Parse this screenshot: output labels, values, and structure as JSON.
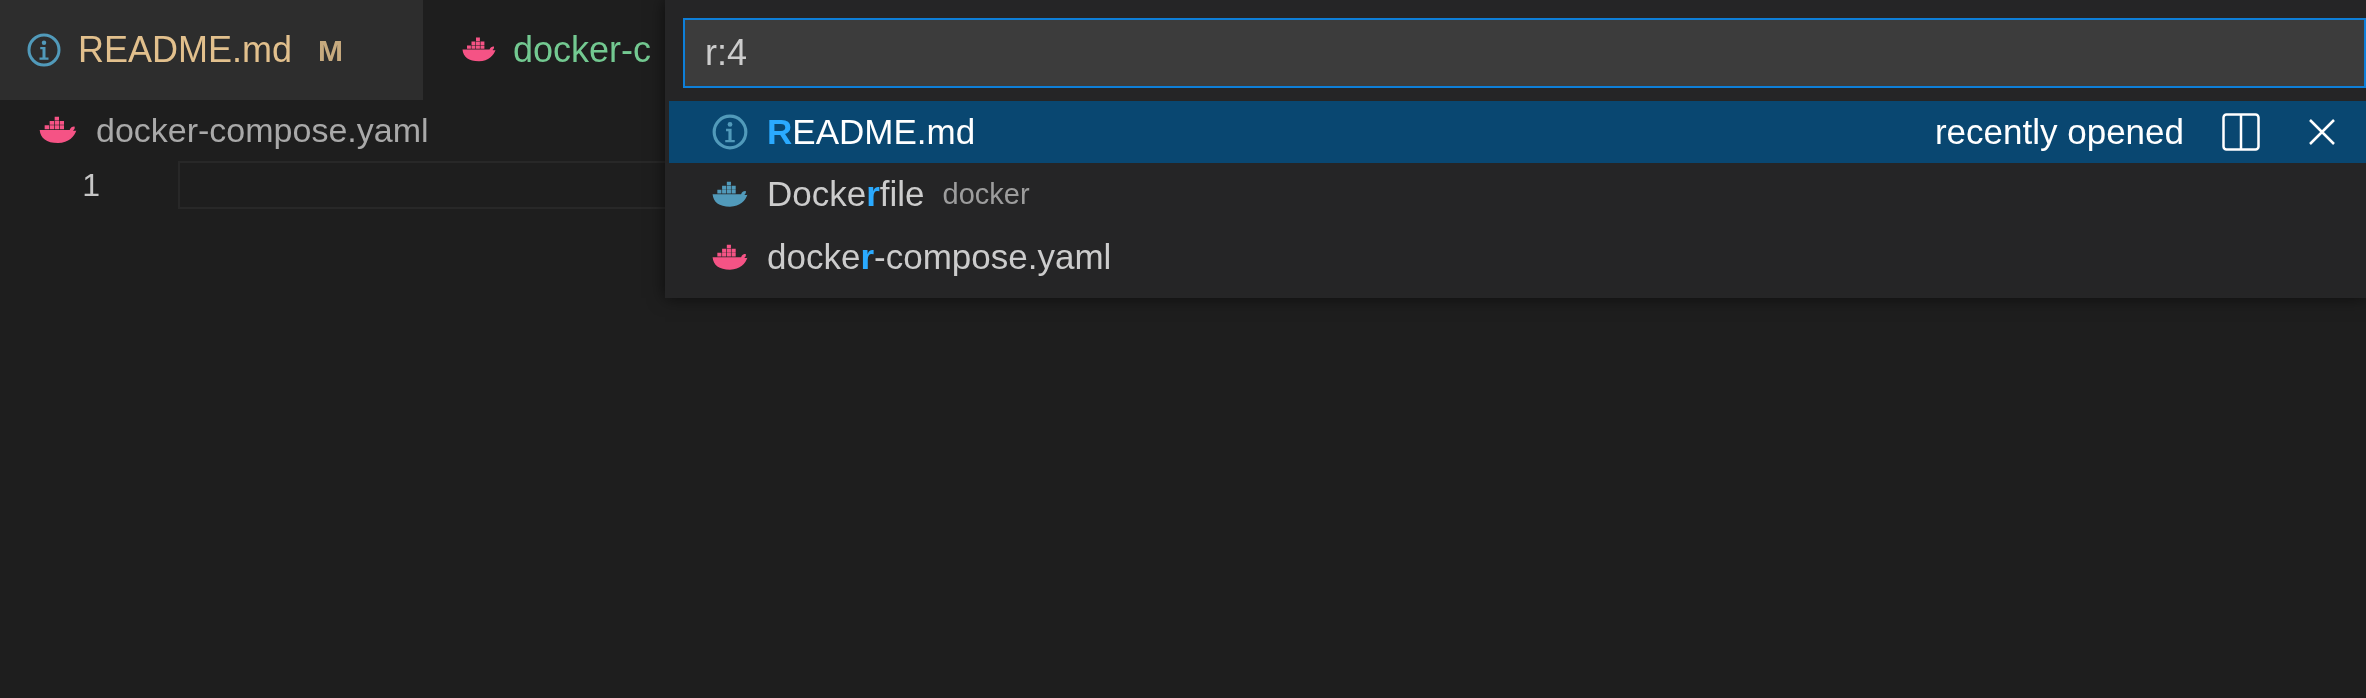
{
  "tabs": [
    {
      "label": "README.md",
      "kind": "info",
      "color": "#e2c08d",
      "badge": "M",
      "selected": false
    },
    {
      "label": "docker-c",
      "kind": "compose",
      "color": "#73c991",
      "selected": true
    }
  ],
  "breadcrumb": {
    "label": "docker-compose.yaml",
    "kind": "compose"
  },
  "editor": {
    "line_numbers": [
      "1"
    ]
  },
  "quick_open": {
    "value": "r:4",
    "items": [
      {
        "label": "**R**EADME.md",
        "kind": "info",
        "detail": "recently opened",
        "selected": true
      },
      {
        "label": "Docke**r**file",
        "description": "docker",
        "kind": "dockerfile",
        "selected": false
      },
      {
        "label": "docke**r**-compose.yaml",
        "kind": "compose",
        "selected": false
      }
    ]
  }
}
